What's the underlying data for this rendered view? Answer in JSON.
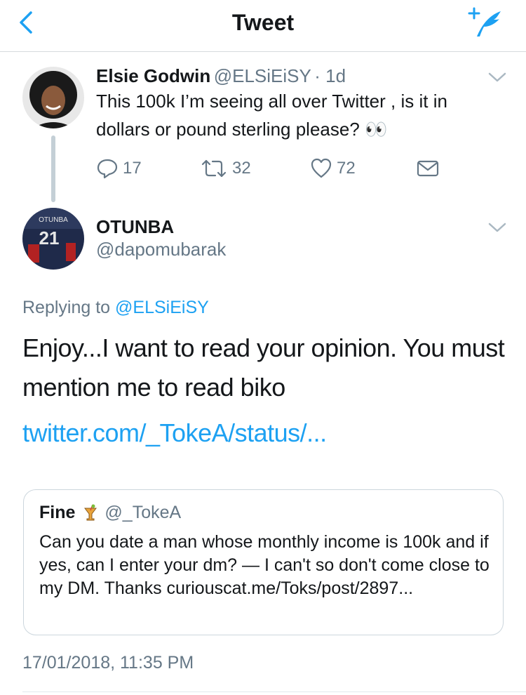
{
  "header": {
    "title": "Tweet",
    "accent_color": "#1da1f2"
  },
  "parent_tweet": {
    "name": "Elsie Godwin",
    "handle": "@ELSiEiSY",
    "time": "· 1d",
    "text": "This 100k I’m seeing all over Twitter , is it in dollars or pound sterling please? 👀",
    "reply_count": "17",
    "retweet_count": "32",
    "like_count": "72"
  },
  "reply_tweet": {
    "name": "OTUNBA",
    "handle": "@dapomubarak",
    "avatar_jersey_text": "OTUNBA",
    "avatar_jersey_number": "21",
    "replying_prefix": "Replying to",
    "replying_to": "@ELSiEiSY",
    "text": "Enjoy...I want to read your opinion. You must mention me to read biko",
    "link": "twitter.com/_TokeA/status/...",
    "timestamp": "17/01/2018, 11:35 PM"
  },
  "quoted_tweet": {
    "name": "Fine",
    "emoji": "tropical-drink",
    "handle": "@_TokeA",
    "text": "Can you date a man whose monthly income is 100k and if yes, can I enter your dm? — I can't so don't come close to my DM. Thanks curiouscat.me/Toks/post/2897..."
  },
  "icons": {
    "back": "chevron-left-icon",
    "compose": "compose-tweet-icon",
    "options": "chevron-down-icon",
    "reply": "reply-icon",
    "retweet": "retweet-icon",
    "like": "heart-icon",
    "dm": "envelope-icon"
  }
}
